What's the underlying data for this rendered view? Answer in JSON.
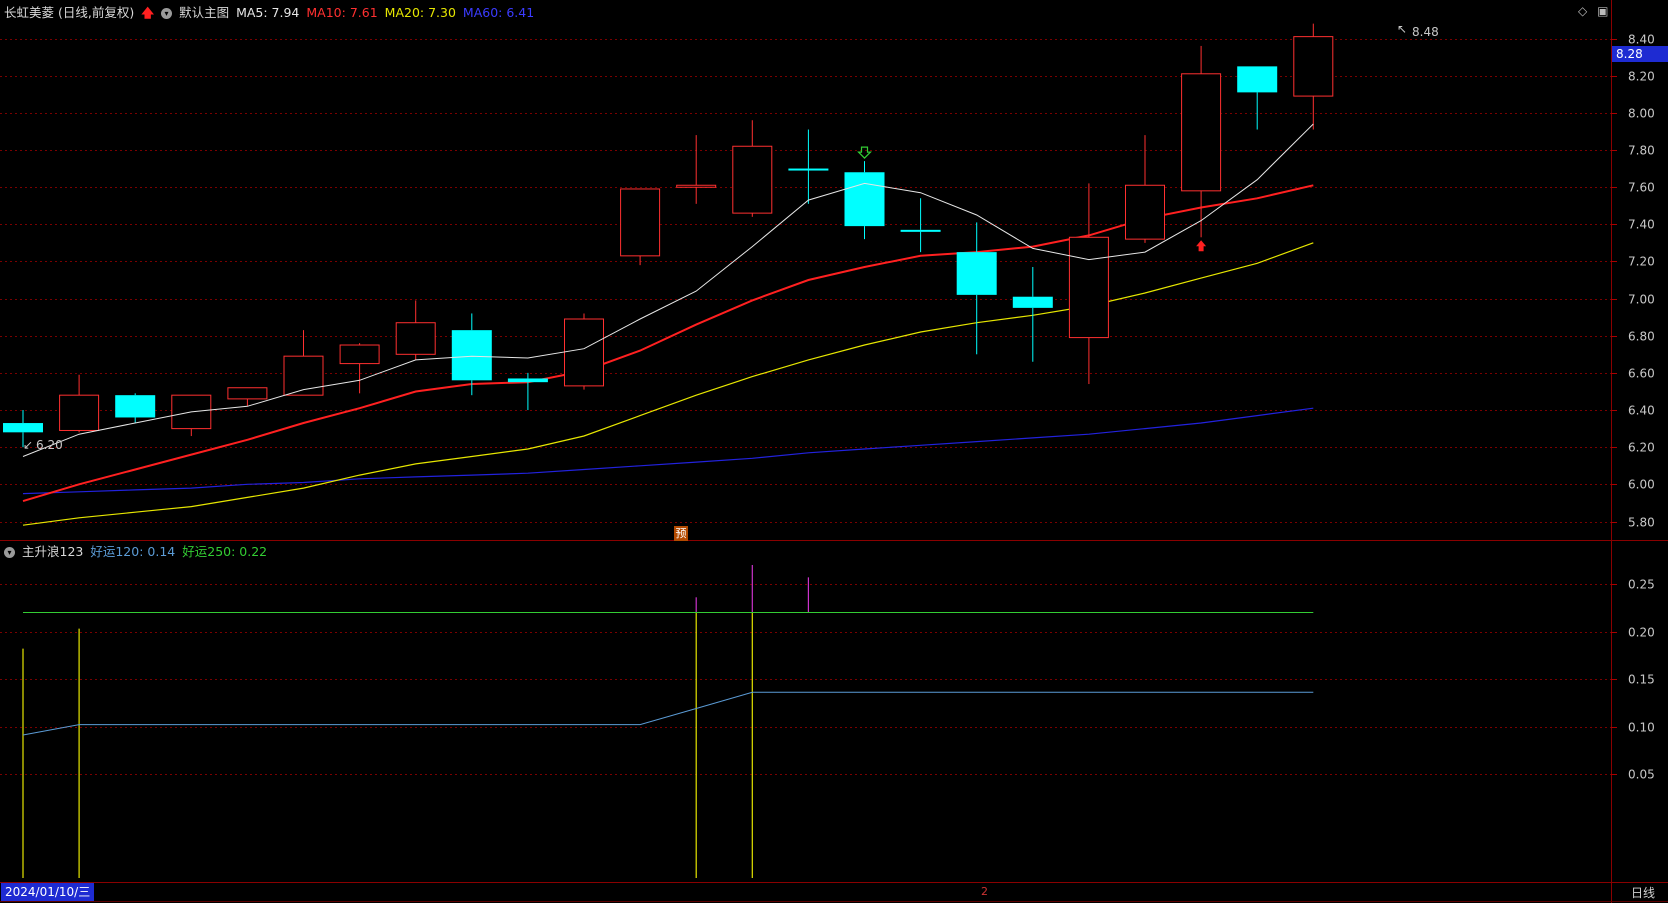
{
  "main_header": {
    "stock": "长虹美菱 (日线,前复权)",
    "template": "默认主图",
    "ma5_label": "MA5: 7.94",
    "ma10_label": "MA10: 7.61",
    "ma20_label": "MA20: 7.30",
    "ma60_label": "MA60: 6.41"
  },
  "sub_header": {
    "indicator": "主升浪123",
    "line1_label": "好运120: 0.14",
    "line2_label": "好运250: 0.22"
  },
  "colors": {
    "up": "#ff3030",
    "down": "#00ffff",
    "ma5": "#e6e6e6",
    "ma10": "#ff2020",
    "ma20": "#e6e600",
    "ma60": "#2222dd",
    "haoyun120": "#5b9bd5",
    "haoyun250": "#33cc33",
    "grid": "#7a0000"
  },
  "price_axis": {
    "ticks": [
      "8.40",
      "8.20",
      "8.00",
      "7.80",
      "7.60",
      "7.40",
      "7.20",
      "7.00",
      "6.80",
      "6.60",
      "6.40",
      "6.20",
      "6.00",
      "5.80"
    ],
    "current_price": "8.28",
    "high_label": "8.48",
    "low_label": "6.20"
  },
  "indicator_axis": {
    "ticks": [
      "0.25",
      "0.20",
      "0.15",
      "0.10",
      "0.05"
    ]
  },
  "footer": {
    "date": "2024/01/10/三",
    "period": "日线",
    "page_marker": "2",
    "predict_marker": "预"
  },
  "chart_data": [
    {
      "type": "candlestick",
      "y_range": [
        5.75,
        8.5
      ],
      "candles": [
        {
          "o": 6.33,
          "c": 6.28,
          "h": 6.4,
          "l": 6.2
        },
        {
          "o": 6.29,
          "c": 6.48,
          "h": 6.59,
          "l": 6.28
        },
        {
          "o": 6.48,
          "c": 6.36,
          "h": 6.49,
          "l": 6.33
        },
        {
          "o": 6.3,
          "c": 6.48,
          "h": 6.48,
          "l": 6.26
        },
        {
          "o": 6.46,
          "c": 6.52,
          "h": 6.52,
          "l": 6.42
        },
        {
          "o": 6.48,
          "c": 6.69,
          "h": 6.83,
          "l": 6.48
        },
        {
          "o": 6.65,
          "c": 6.75,
          "h": 6.76,
          "l": 6.49
        },
        {
          "o": 6.7,
          "c": 6.87,
          "h": 6.99,
          "l": 6.67
        },
        {
          "o": 6.83,
          "c": 6.56,
          "h": 6.92,
          "l": 6.48
        },
        {
          "o": 6.57,
          "c": 6.55,
          "h": 6.6,
          "l": 6.4
        },
        {
          "o": 6.53,
          "c": 6.89,
          "h": 6.92,
          "l": 6.51
        },
        {
          "o": 7.23,
          "c": 7.59,
          "h": 7.59,
          "l": 7.18
        },
        {
          "o": 7.61,
          "c": 7.61,
          "h": 7.88,
          "l": 7.51
        },
        {
          "o": 7.46,
          "c": 7.82,
          "h": 7.96,
          "l": 7.44
        },
        {
          "o": 7.7,
          "c": 7.69,
          "h": 7.91,
          "l": 7.51
        },
        {
          "o": 7.68,
          "c": 7.39,
          "h": 7.74,
          "l": 7.32
        },
        {
          "o": 7.37,
          "c": 7.36,
          "h": 7.54,
          "l": 7.25
        },
        {
          "o": 7.25,
          "c": 7.02,
          "h": 7.41,
          "l": 6.7
        },
        {
          "o": 7.01,
          "c": 6.95,
          "h": 7.17,
          "l": 6.66
        },
        {
          "o": 6.79,
          "c": 7.33,
          "h": 7.62,
          "l": 6.54
        },
        {
          "o": 7.32,
          "c": 7.61,
          "h": 7.88,
          "l": 7.3
        },
        {
          "o": 7.58,
          "c": 8.21,
          "h": 8.36,
          "l": 7.33
        },
        {
          "o": 8.25,
          "c": 8.11,
          "h": 8.25,
          "l": 7.91
        },
        {
          "o": 8.09,
          "c": 8.41,
          "h": 8.48,
          "l": 7.91
        }
      ],
      "ma5": [
        6.15,
        6.27,
        6.33,
        6.39,
        6.42,
        6.51,
        6.56,
        6.67,
        6.69,
        6.68,
        6.73,
        6.89,
        7.04,
        7.28,
        7.53,
        7.62,
        7.57,
        7.45,
        7.27,
        7.21,
        7.25,
        7.42,
        7.64,
        7.94
      ],
      "ma10": [
        5.91,
        6.0,
        6.08,
        6.16,
        6.24,
        6.33,
        6.41,
        6.5,
        6.54,
        6.55,
        6.61,
        6.72,
        6.86,
        6.99,
        7.1,
        7.17,
        7.23,
        7.25,
        7.28,
        7.34,
        7.43,
        7.49,
        7.54,
        7.61
      ],
      "ma20": [
        5.78,
        5.82,
        5.85,
        5.88,
        5.93,
        5.98,
        6.05,
        6.11,
        6.15,
        6.19,
        6.26,
        6.37,
        6.48,
        6.58,
        6.67,
        6.75,
        6.82,
        6.87,
        6.91,
        6.96,
        7.03,
        7.11,
        7.19,
        7.3
      ],
      "ma60": [
        5.95,
        5.96,
        5.97,
        5.98,
        6.0,
        6.01,
        6.03,
        6.04,
        6.05,
        6.06,
        6.08,
        6.1,
        6.12,
        6.14,
        6.17,
        6.19,
        6.21,
        6.23,
        6.25,
        6.27,
        6.3,
        6.33,
        6.37,
        6.41
      ],
      "markers": [
        {
          "index": 15,
          "kind": "hollow-down-arrow",
          "color": "#33cc33"
        },
        {
          "index": 21,
          "kind": "up-arrow",
          "color": "#ff2020"
        }
      ]
    },
    {
      "type": "line",
      "name": "主升浪123",
      "y_range": [
        0,
        0.28
      ],
      "haoyun120": [
        0.091,
        0.102,
        0.102,
        0.102,
        0.102,
        0.102,
        0.102,
        0.102,
        0.102,
        0.102,
        0.102,
        0.102,
        0.119,
        0.136,
        0.136,
        0.136,
        0.136,
        0.136,
        0.136,
        0.136,
        0.136,
        0.136,
        0.136,
        0.136
      ],
      "haoyun250": [
        0.22,
        0.22,
        0.22,
        0.22,
        0.22,
        0.22,
        0.22,
        0.22,
        0.22,
        0.22,
        0.22,
        0.22,
        0.22,
        0.22,
        0.22,
        0.22,
        0.22,
        0.22,
        0.22,
        0.22,
        0.22,
        0.22,
        0.22,
        0.22
      ],
      "yellow_bars": [
        {
          "index": 0,
          "value": 0.182
        },
        {
          "index": 1,
          "value": 0.203
        },
        {
          "index": 12,
          "value": 0.22
        },
        {
          "index": 13,
          "value": 0.22
        }
      ],
      "purple_bars": [
        {
          "index": 12,
          "value": 0.236
        },
        {
          "index": 13,
          "value": 0.27
        },
        {
          "index": 14,
          "value": 0.257
        }
      ]
    }
  ]
}
